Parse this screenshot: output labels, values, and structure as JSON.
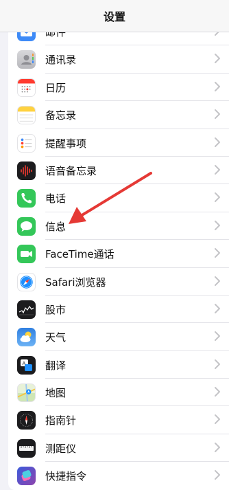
{
  "header": {
    "title": "设置"
  },
  "rows": [
    {
      "label": "邮件",
      "icon": "mail-icon",
      "color": "#3d8af7"
    },
    {
      "label": "通讯录",
      "icon": "contacts-icon",
      "color": "#c9c9cc"
    },
    {
      "label": "日历",
      "icon": "calendar-icon",
      "color": "#ffffff"
    },
    {
      "label": "备忘录",
      "icon": "notes-icon",
      "color": "#ffffff"
    },
    {
      "label": "提醒事项",
      "icon": "reminders-icon",
      "color": "#ffffff"
    },
    {
      "label": "语音备忘录",
      "icon": "voice-memos-icon",
      "color": "#1c1c1e"
    },
    {
      "label": "电话",
      "icon": "phone-icon",
      "color": "#34c759"
    },
    {
      "label": "信息",
      "icon": "messages-icon",
      "color": "#34c759"
    },
    {
      "label": "FaceTime通话",
      "icon": "facetime-icon",
      "color": "#34c759"
    },
    {
      "label": "Safari浏览器",
      "icon": "safari-icon",
      "color": "#ffffff"
    },
    {
      "label": "股市",
      "icon": "stocks-icon",
      "color": "#1c1c1e"
    },
    {
      "label": "天气",
      "icon": "weather-icon",
      "color": "#3a8ee6"
    },
    {
      "label": "翻译",
      "icon": "translate-icon",
      "color": "#1c1c1e"
    },
    {
      "label": "地图",
      "icon": "maps-icon",
      "color": "#e8f2d8"
    },
    {
      "label": "指南针",
      "icon": "compass-icon",
      "color": "#1c1c1e"
    },
    {
      "label": "测距仪",
      "icon": "measure-icon",
      "color": "#1c1c1e"
    },
    {
      "label": "快捷指令",
      "icon": "shortcuts-icon",
      "color": "#4b3fce"
    }
  ],
  "annotation": {
    "icon": "red-arrow-icon",
    "color": "#e53935"
  }
}
